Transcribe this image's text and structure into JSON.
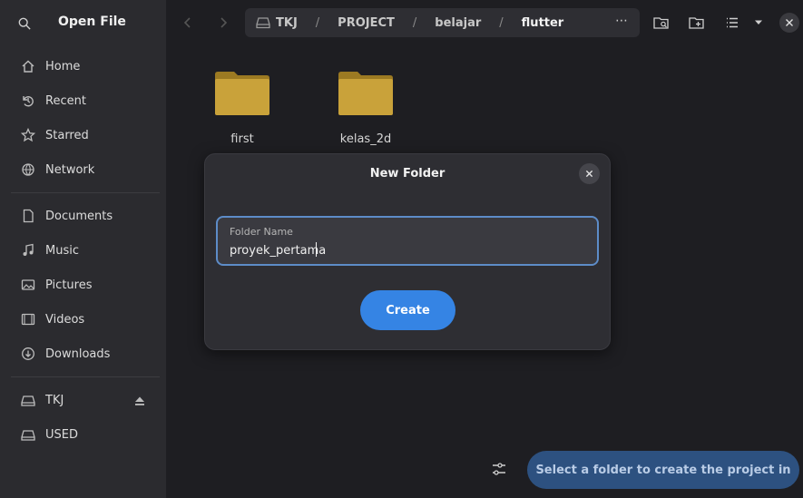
{
  "sidebar": {
    "title": "Open File",
    "items": [
      {
        "label": "Home",
        "icon": "home-icon"
      },
      {
        "label": "Recent",
        "icon": "clock-icon"
      },
      {
        "label": "Starred",
        "icon": "star-icon"
      },
      {
        "label": "Network",
        "icon": "network-icon"
      },
      {
        "label": "Documents",
        "icon": "document-icon"
      },
      {
        "label": "Music",
        "icon": "music-icon"
      },
      {
        "label": "Pictures",
        "icon": "picture-icon"
      },
      {
        "label": "Videos",
        "icon": "video-icon"
      },
      {
        "label": "Downloads",
        "icon": "download-icon"
      },
      {
        "label": "TKJ",
        "icon": "drive-icon"
      },
      {
        "label": "USED",
        "icon": "drive-icon"
      }
    ]
  },
  "path": {
    "crumbs": [
      "TKJ",
      "PROJECT",
      "belajar",
      "flutter"
    ],
    "separator": "/"
  },
  "folders": [
    {
      "name": "first"
    },
    {
      "name": "kelas_2d"
    }
  ],
  "dialog": {
    "title": "New Folder",
    "field_label": "Folder Name",
    "field_value": "proyek_pertama",
    "create_label": "Create"
  },
  "bottom": {
    "primary_label": "Select a folder to create the project in"
  },
  "colors": {
    "accent": "#3584e4",
    "folder": "#c9a23a",
    "sidebar_bg": "#2b2b2f",
    "main_bg": "#1e1e22"
  }
}
